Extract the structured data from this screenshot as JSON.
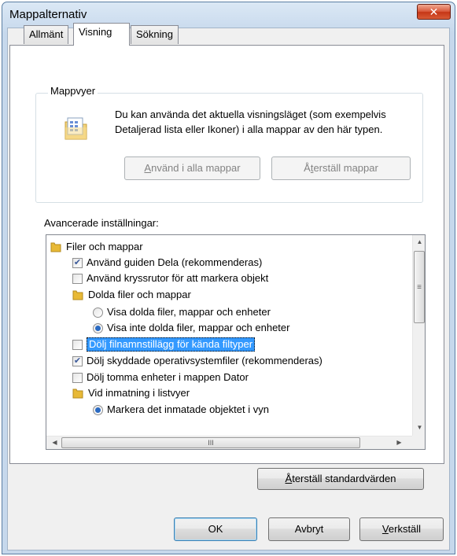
{
  "window": {
    "title": "Mappalternativ",
    "close_glyph": "✕"
  },
  "tabs": [
    {
      "label": "Allmänt"
    },
    {
      "label": "Visning",
      "selected": true
    },
    {
      "label": "Sökning"
    }
  ],
  "folder_views": {
    "group_label": "Mappvyer",
    "icon": "folder-view-icon",
    "description": "Du kan använda det aktuella visningsläget (som exempelvis Detaljerad lista eller Ikoner) i alla mappar av den här typen.",
    "apply_all": {
      "pre": "",
      "mnemonic": "A",
      "post": "nvänd i alla mappar",
      "enabled": false
    },
    "reset_folders": {
      "pre": "Å",
      "mnemonic": "t",
      "post": "erställ mappar",
      "enabled": false
    }
  },
  "advanced": {
    "label": "Avancerade inställningar:",
    "items": [
      {
        "type": "folder",
        "label": "Filer och mappar"
      },
      {
        "type": "checkbox",
        "label": "Använd guiden Dela (rekommenderas)",
        "checked": true
      },
      {
        "type": "checkbox",
        "label": "Använd kryssrutor för att markera objekt",
        "checked": false
      },
      {
        "type": "folder",
        "label": "Dolda filer och mappar"
      },
      {
        "type": "radio",
        "label": "Visa dolda filer, mappar och enheter",
        "checked": false
      },
      {
        "type": "radio",
        "label": "Visa inte dolda filer, mappar och enheter",
        "checked": true
      },
      {
        "type": "checkbox",
        "label": "Dölj filnamnstillägg för kända filtyper",
        "checked": false,
        "selected": true
      },
      {
        "type": "checkbox",
        "label": "Dölj skyddade operativsystemfiler (rekommenderas)",
        "checked": true
      },
      {
        "type": "checkbox",
        "label": "Dölj tomma enheter i mappen Dator",
        "checked": false
      },
      {
        "type": "folder",
        "label": "Vid inmatning i listvyer"
      },
      {
        "type": "radio",
        "label": "Markera det inmatade objektet i vyn",
        "checked": true
      }
    ],
    "scroll_grip": "≡",
    "hscroll_grip": "III",
    "reset_defaults": {
      "pre": "",
      "mnemonic": "Å",
      "post": "terställ standardvärden"
    }
  },
  "footer": {
    "ok": "OK",
    "cancel": "Avbryt",
    "apply": {
      "pre": "",
      "mnemonic": "V",
      "post": "erkställ",
      "enabled": true
    }
  },
  "colors": {
    "selection": "#3399ff",
    "close_button": "#c63616",
    "folder": "#e8b936"
  }
}
